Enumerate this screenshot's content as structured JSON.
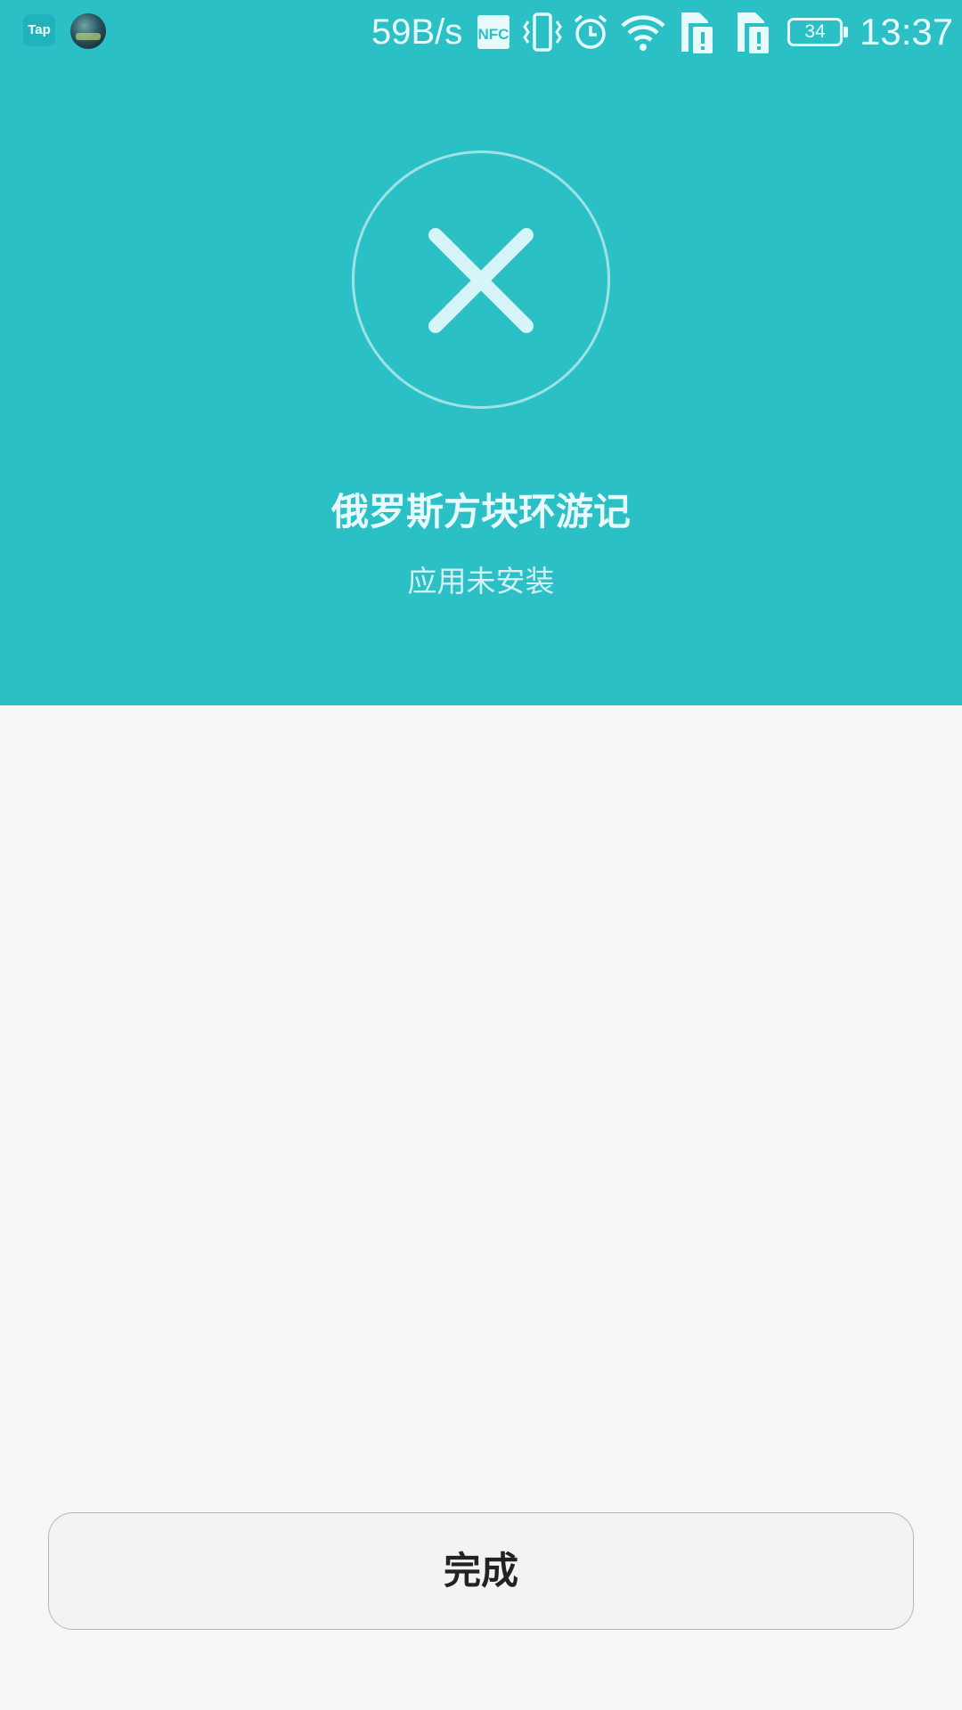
{
  "status_bar": {
    "app_icon_label": "Tap",
    "net_speed": "59B/s",
    "nfc_label": "NFC",
    "battery_level": "34",
    "time": "13:37",
    "icons": [
      "tap-app-icon",
      "avatar-icon",
      "nfc-icon",
      "vibrate-icon",
      "alarm-icon",
      "wifi-icon",
      "sim-alert-icon",
      "sim-alert-icon",
      "battery-icon"
    ]
  },
  "result": {
    "icon": "close-icon",
    "app_name": "俄罗斯方块环游记",
    "status": "应用未安装"
  },
  "actions": {
    "done_label": "完成"
  },
  "colors": {
    "header_bg": "#2bbfc6",
    "page_bg": "#f7f7f7",
    "icon_fg": "#d6f5f6"
  }
}
